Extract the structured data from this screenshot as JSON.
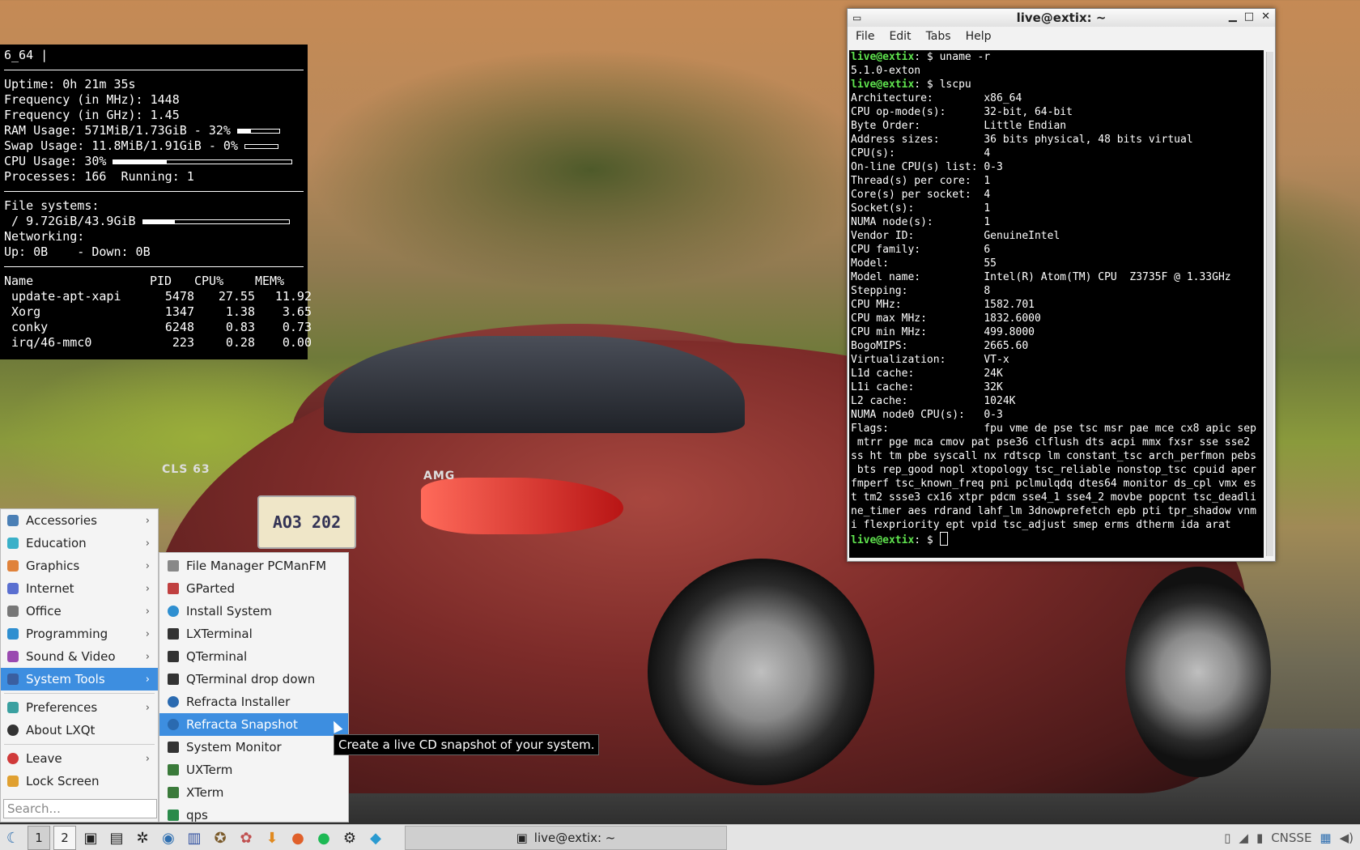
{
  "conky": {
    "top_line": "6_64 |",
    "uptime": "Uptime: 0h 21m 35s",
    "freq_mhz": "Frequency (in MHz): 1448",
    "freq_ghz": "Frequency (in GHz): 1.45",
    "ram": "RAM Usage: 571MiB/1.73GiB - 32%",
    "ram_pct": 32,
    "swap": "Swap Usage: 11.8MiB/1.91GiB - 0%",
    "swap_pct": 0,
    "cpu": "CPU Usage: 30%",
    "cpu_pct": 30,
    "processes": "Processes: 166  Running: 1",
    "fs_title": "File systems:",
    "fs_root": " / 9.72GiB/43.9GiB",
    "fs_pct": 22,
    "net_title": "Networking:",
    "net": "Up: 0B    - Down: 0B",
    "table_headers": [
      "Name",
      "PID",
      "CPU%",
      "MEM%"
    ],
    "procs": [
      {
        "name": " update-apt-xapi",
        "pid": "5478",
        "cpu": "27.55",
        "mem": "11.92"
      },
      {
        "name": " Xorg",
        "pid": "1347",
        "cpu": "1.38",
        "mem": "3.65"
      },
      {
        "name": " conky",
        "pid": "6248",
        "cpu": "0.83",
        "mem": "0.73"
      },
      {
        "name": " irq/46-mmc0",
        "pid": "223",
        "cpu": "0.28",
        "mem": "0.00"
      }
    ]
  },
  "terminal": {
    "title": "live@extix: ~",
    "menu": [
      "File",
      "Edit",
      "Tabs",
      "Help"
    ],
    "prompt": "live@extix",
    "lines": [
      {
        "type": "cmd",
        "text": ": $ uname -r"
      },
      {
        "type": "out",
        "text": "5.1.0-exton"
      },
      {
        "type": "cmd",
        "text": ": $ lscpu"
      },
      {
        "type": "out",
        "text": "Architecture:        x86_64"
      },
      {
        "type": "out",
        "text": "CPU op-mode(s):      32-bit, 64-bit"
      },
      {
        "type": "out",
        "text": "Byte Order:          Little Endian"
      },
      {
        "type": "out",
        "text": "Address sizes:       36 bits physical, 48 bits virtual"
      },
      {
        "type": "out",
        "text": "CPU(s):              4"
      },
      {
        "type": "out",
        "text": "On-line CPU(s) list: 0-3"
      },
      {
        "type": "out",
        "text": "Thread(s) per core:  1"
      },
      {
        "type": "out",
        "text": "Core(s) per socket:  4"
      },
      {
        "type": "out",
        "text": "Socket(s):           1"
      },
      {
        "type": "out",
        "text": "NUMA node(s):        1"
      },
      {
        "type": "out",
        "text": "Vendor ID:           GenuineIntel"
      },
      {
        "type": "out",
        "text": "CPU family:          6"
      },
      {
        "type": "out",
        "text": "Model:               55"
      },
      {
        "type": "out",
        "text": "Model name:          Intel(R) Atom(TM) CPU  Z3735F @ 1.33GHz"
      },
      {
        "type": "out",
        "text": "Stepping:            8"
      },
      {
        "type": "out",
        "text": "CPU MHz:             1582.701"
      },
      {
        "type": "out",
        "text": "CPU max MHz:         1832.6000"
      },
      {
        "type": "out",
        "text": "CPU min MHz:         499.8000"
      },
      {
        "type": "out",
        "text": "BogoMIPS:            2665.60"
      },
      {
        "type": "out",
        "text": "Virtualization:      VT-x"
      },
      {
        "type": "out",
        "text": "L1d cache:           24K"
      },
      {
        "type": "out",
        "text": "L1i cache:           32K"
      },
      {
        "type": "out",
        "text": "L2 cache:            1024K"
      },
      {
        "type": "out",
        "text": "NUMA node0 CPU(s):   0-3"
      },
      {
        "type": "out",
        "text": "Flags:               fpu vme de pse tsc msr pae mce cx8 apic sep"
      },
      {
        "type": "out",
        "text": " mtrr pge mca cmov pat pse36 clflush dts acpi mmx fxsr sse sse2"
      },
      {
        "type": "out",
        "text": "ss ht tm pbe syscall nx rdtscp lm constant_tsc arch_perfmon pebs"
      },
      {
        "type": "out",
        "text": " bts rep_good nopl xtopology tsc_reliable nonstop_tsc cpuid aper"
      },
      {
        "type": "out",
        "text": "fmperf tsc_known_freq pni pclmulqdq dtes64 monitor ds_cpl vmx es"
      },
      {
        "type": "out",
        "text": "t tm2 ssse3 cx16 xtpr pdcm sse4_1 sse4_2 movbe popcnt tsc_deadli"
      },
      {
        "type": "out",
        "text": "ne_timer aes rdrand lahf_lm 3dnowprefetch epb pti tpr_shadow vnm"
      },
      {
        "type": "out",
        "text": "i flexpriority ept vpid tsc_adjust smep erms dtherm ida arat"
      },
      {
        "type": "cmd",
        "text": ": $ "
      }
    ]
  },
  "menu": {
    "categories": [
      {
        "label": "Accessories",
        "color": "#4a7fb5"
      },
      {
        "label": "Education",
        "color": "#3ab0c8"
      },
      {
        "label": "Graphics",
        "color": "#e0823a"
      },
      {
        "label": "Internet",
        "color": "#5a6fd0"
      },
      {
        "label": "Office",
        "color": "#777777"
      },
      {
        "label": "Programming",
        "color": "#2f8fd0"
      },
      {
        "label": "Sound & Video",
        "color": "#9a4ab0"
      },
      {
        "label": "System Tools",
        "color": "#3a5fa0"
      }
    ],
    "lower": [
      {
        "label": "Preferences",
        "color": "#3aa0a0",
        "arrow": true
      },
      {
        "label": "About LXQt",
        "color": "#333333",
        "arrow": false
      }
    ],
    "bottom": [
      {
        "label": "Leave",
        "color": "#d03a3a",
        "arrow": true
      },
      {
        "label": "Lock Screen",
        "color": "#e0a030",
        "arrow": false
      }
    ],
    "search_placeholder": "Search..."
  },
  "submenu": {
    "items": [
      {
        "label": "File Manager PCManFM",
        "color": "#888888"
      },
      {
        "label": "GParted",
        "color": "#c04040"
      },
      {
        "label": "Install System",
        "color": "#2f8fd0"
      },
      {
        "label": "LXTerminal",
        "color": "#333333"
      },
      {
        "label": "QTerminal",
        "color": "#333333"
      },
      {
        "label": "QTerminal drop down",
        "color": "#333333"
      },
      {
        "label": "Refracta Installer",
        "color": "#2a6ab0"
      },
      {
        "label": "Refracta Snapshot",
        "color": "#2a6ab0"
      },
      {
        "label": "System Monitor",
        "color": "#333333"
      },
      {
        "label": "UXTerm",
        "color": "#3a7a3a"
      },
      {
        "label": "XTerm",
        "color": "#3a7a3a"
      },
      {
        "label": "qps",
        "color": "#2a8a4a"
      }
    ]
  },
  "tooltip": "Create a live CD snapshot of your system.",
  "taskbar": {
    "desktops": [
      "1",
      "2"
    ],
    "window_title": "live@extix: ~",
    "tray_text": "CNSSE"
  },
  "wallpaper": {
    "plate_text": "AO3 202",
    "badge_left": "CLS 63",
    "badge_right": "AMG"
  }
}
